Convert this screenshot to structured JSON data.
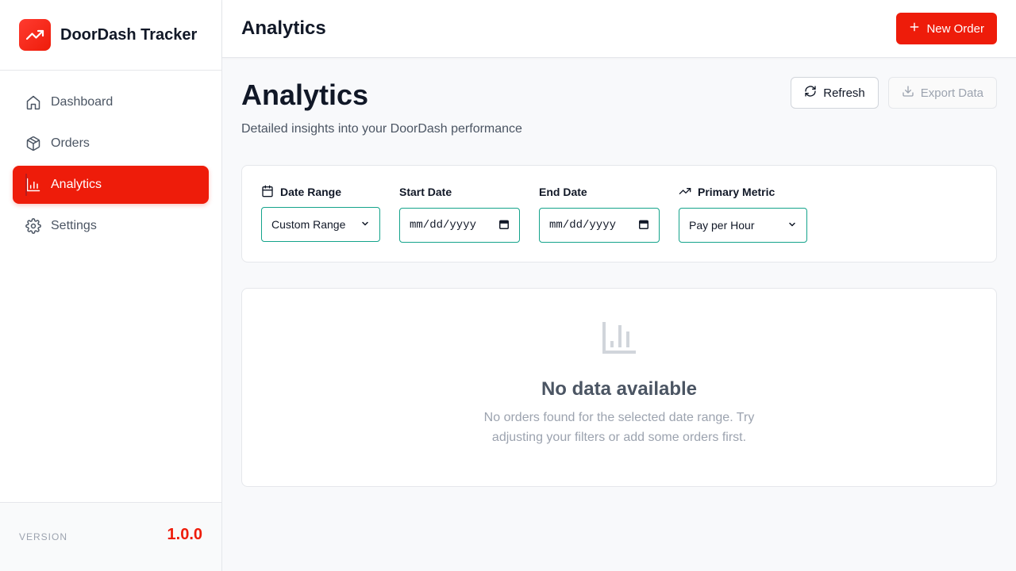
{
  "app": {
    "name": "DoorDash Tracker",
    "version_label": "VERSION",
    "version": "1.0.0"
  },
  "sidebar": {
    "items": [
      {
        "label": "Dashboard",
        "icon": "home-icon",
        "active": false
      },
      {
        "label": "Orders",
        "icon": "package-icon",
        "active": false
      },
      {
        "label": "Analytics",
        "icon": "bar-chart-icon",
        "active": true
      },
      {
        "label": "Settings",
        "icon": "gear-icon",
        "active": false
      }
    ]
  },
  "topbar": {
    "title": "Analytics",
    "new_order_label": "New Order"
  },
  "page": {
    "title": "Analytics",
    "subtitle": "Detailed insights into your DoorDash performance",
    "refresh_label": "Refresh",
    "export_label": "Export Data"
  },
  "filters": {
    "date_range": {
      "label": "Date Range",
      "value": "Custom Range"
    },
    "start_date": {
      "label": "Start Date",
      "value": "mm/dd/yyyy"
    },
    "end_date": {
      "label": "End Date",
      "value": "mm/dd/yyyy"
    },
    "primary_metric": {
      "label": "Primary Metric",
      "value": "Pay per Hour"
    }
  },
  "empty_state": {
    "title": "No data available",
    "message": "No orders found for the selected date range. Try adjusting your filters or add some orders first."
  },
  "colors": {
    "accent": "#ee1c0a",
    "focus_border": "#14a38b"
  }
}
